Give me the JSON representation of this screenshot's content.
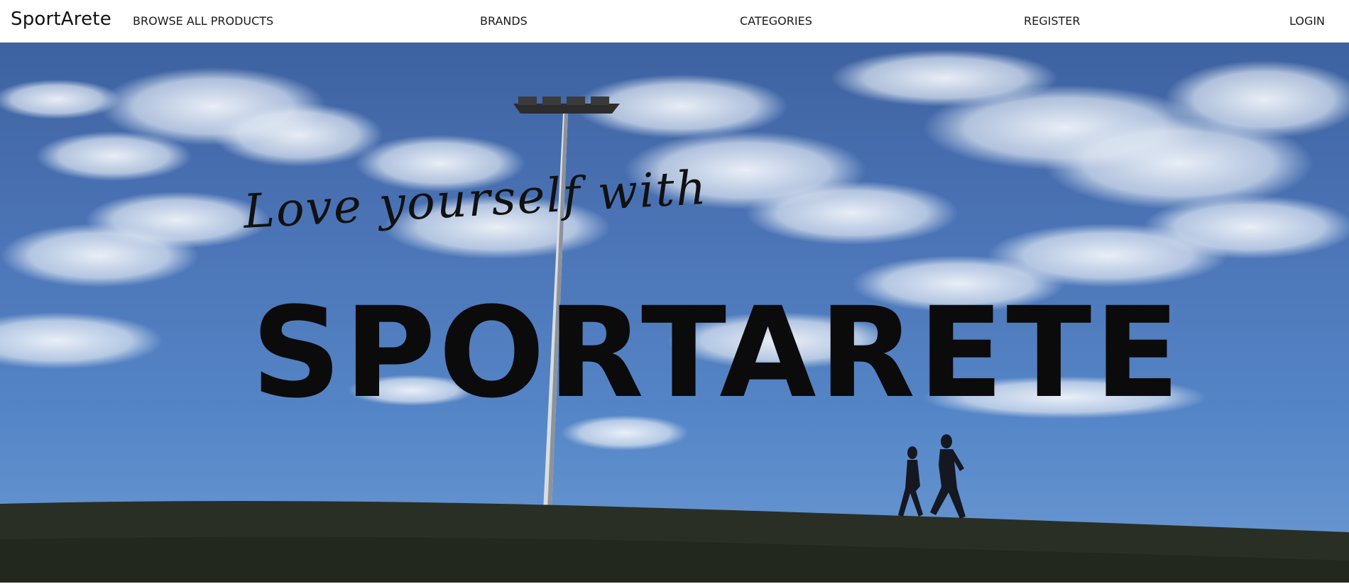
{
  "navbar": {
    "brand": "SportArete",
    "links": [
      {
        "id": "browse",
        "label": "BROWSE ALL PRODUCTS"
      },
      {
        "id": "brands",
        "label": "BRANDS"
      },
      {
        "id": "categories",
        "label": "CATEGORIES"
      },
      {
        "id": "register",
        "label": "REGISTER"
      },
      {
        "id": "login",
        "label": "LOGIN"
      }
    ]
  },
  "hero": {
    "script_text": "Love yourself with",
    "title": "SPORTARETE",
    "sky_color": "#4b74b6",
    "cloud_color": "#e8eef7",
    "ground_color": "#2a2f25"
  }
}
